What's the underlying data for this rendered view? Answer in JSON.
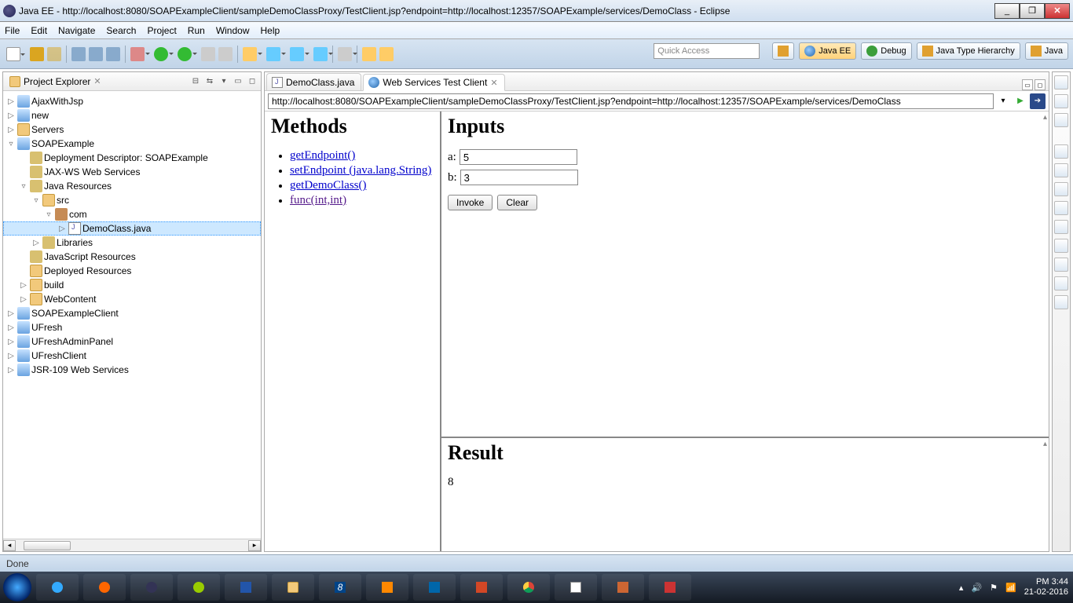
{
  "window": {
    "title": "Java EE - http://localhost:8080/SOAPExampleClient/sampleDemoClassProxy/TestClient.jsp?endpoint=http://localhost:12357/SOAPExample/services/DemoClass - Eclipse"
  },
  "menu": [
    "File",
    "Edit",
    "Navigate",
    "Search",
    "Project",
    "Run",
    "Window",
    "Help"
  ],
  "quickAccess": "Quick Access",
  "perspectives": [
    {
      "label": "Java EE",
      "active": true
    },
    {
      "label": "Debug"
    },
    {
      "label": "Java Type Hierarchy"
    },
    {
      "label": "Java"
    }
  ],
  "explorer": {
    "title": "Project Explorer",
    "tree": [
      {
        "depth": 0,
        "exp": "▷",
        "icon": "ic-proj",
        "label": "AjaxWithJsp"
      },
      {
        "depth": 0,
        "exp": "▷",
        "icon": "ic-proj",
        "label": "new"
      },
      {
        "depth": 0,
        "exp": "▷",
        "icon": "ic-folder",
        "label": "Servers"
      },
      {
        "depth": 0,
        "exp": "▿",
        "icon": "ic-proj",
        "label": "SOAPExample"
      },
      {
        "depth": 1,
        "exp": " ",
        "icon": "ic-jar",
        "label": "Deployment Descriptor: SOAPExample"
      },
      {
        "depth": 1,
        "exp": " ",
        "icon": "ic-jar",
        "label": "JAX-WS Web Services"
      },
      {
        "depth": 1,
        "exp": "▿",
        "icon": "ic-jar",
        "label": "Java Resources"
      },
      {
        "depth": 2,
        "exp": "▿",
        "icon": "ic-folder",
        "label": "src"
      },
      {
        "depth": 3,
        "exp": "▿",
        "icon": "ic-pkg",
        "label": "com"
      },
      {
        "depth": 4,
        "exp": "▷",
        "icon": "ic-java",
        "label": "DemoClass.java",
        "selected": true
      },
      {
        "depth": 2,
        "exp": "▷",
        "icon": "ic-jar",
        "label": "Libraries"
      },
      {
        "depth": 1,
        "exp": " ",
        "icon": "ic-jar",
        "label": "JavaScript Resources"
      },
      {
        "depth": 1,
        "exp": " ",
        "icon": "ic-folder",
        "label": "Deployed Resources"
      },
      {
        "depth": 1,
        "exp": "▷",
        "icon": "ic-folder",
        "label": "build"
      },
      {
        "depth": 1,
        "exp": "▷",
        "icon": "ic-folder",
        "label": "WebContent"
      },
      {
        "depth": 0,
        "exp": "▷",
        "icon": "ic-proj",
        "label": "SOAPExampleClient"
      },
      {
        "depth": 0,
        "exp": "▷",
        "icon": "ic-proj",
        "label": "UFresh"
      },
      {
        "depth": 0,
        "exp": "▷",
        "icon": "ic-proj",
        "label": "UFreshAdminPanel"
      },
      {
        "depth": 0,
        "exp": "▷",
        "icon": "ic-proj",
        "label": "UFreshClient"
      },
      {
        "depth": 0,
        "exp": "▷",
        "icon": "ic-proj",
        "label": "JSR-109 Web Services"
      }
    ]
  },
  "editorTabs": [
    {
      "label": "DemoClass.java",
      "icon": "ic-java"
    },
    {
      "label": "Web Services Test Client",
      "icon": "ic-globe",
      "active": true
    }
  ],
  "url": "http://localhost:8080/SOAPExampleClient/sampleDemoClassProxy/TestClient.jsp?endpoint=http://localhost:12357/SOAPExample/services/DemoClass",
  "methods": {
    "heading": "Methods",
    "items": [
      {
        "text": "getEndpoint()"
      },
      {
        "text": "setEndpoint (java.lang.String)"
      },
      {
        "text": "getDemoClass()"
      },
      {
        "text": "func(int,int)",
        "visited": true
      }
    ]
  },
  "inputs": {
    "heading": "Inputs",
    "fields": [
      {
        "label": "a:",
        "value": "5"
      },
      {
        "label": "b:",
        "value": "3"
      }
    ],
    "invoke": "Invoke",
    "clear": "Clear"
  },
  "result": {
    "heading": "Result",
    "value": "8"
  },
  "status": "Done",
  "clock": {
    "time": "PM 3:44",
    "date": "21-02-2016"
  }
}
